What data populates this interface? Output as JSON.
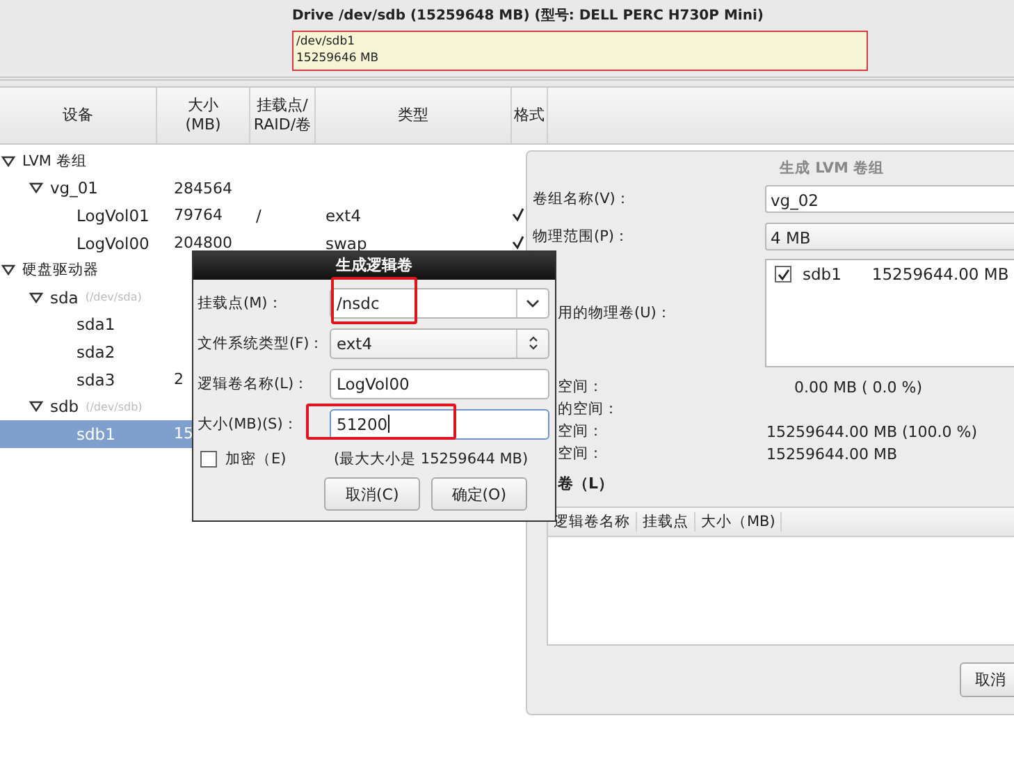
{
  "drive": {
    "title": "Drive /dev/sdb (15259648 MB) (型号: DELL PERC H730P Mini)",
    "partition": {
      "path": "/dev/sdb1",
      "size": "15259646 MB"
    }
  },
  "table": {
    "columns": [
      "设备",
      "大小\n(MB)",
      "挂载点/\nRAID/卷",
      "类型",
      "格式"
    ],
    "rows": [
      {
        "label": "LVM 卷组",
        "expanded": true,
        "selected": false,
        "children": [
          {
            "label": "vg_01",
            "size": "284564",
            "expanded": true,
            "selected": false,
            "children": [
              {
                "label": "LogVol01",
                "size": "79764",
                "mount": "/",
                "type": "ext4",
                "format": true,
                "selected": false
              },
              {
                "label": "LogVol00",
                "size": "204800",
                "type": "swap",
                "format": true,
                "selected": false
              }
            ]
          }
        ]
      },
      {
        "label": "硬盘驱动器",
        "expanded": true,
        "selected": false,
        "children": [
          {
            "label": "sda",
            "path": "(/dev/sda)",
            "expanded": true,
            "selected": false,
            "children": [
              {
                "label": "sda1",
                "selected": false
              },
              {
                "label": "sda2",
                "selected": false
              },
              {
                "label": "sda3",
                "size": "2",
                "selected": false
              }
            ]
          },
          {
            "label": "sdb",
            "path": "(/dev/sdb)",
            "expanded": true,
            "selected": false,
            "children": [
              {
                "label": "sdb1",
                "size": "15",
                "selected": true
              }
            ]
          }
        ]
      }
    ]
  },
  "vg_dialog": {
    "title": "生成 LVM 卷组",
    "name_label": "卷组名称(V)：",
    "name_value": "vg_02",
    "extent_label": "物理范围(P)：",
    "extent_value": "4 MB",
    "pv_label": "用的物理卷(U)：",
    "pvs": [
      {
        "name": "sdb1",
        "size": "15259644.00 MB",
        "checked": true
      }
    ],
    "stats": [
      {
        "label": "空间：",
        "value": "0.00 MB  ( 0.0 %)"
      },
      {
        "label": "的空间："
      },
      {
        "label": "空间：",
        "value": "15259644.00 MB  (100.0 %)"
      },
      {
        "label": "空间：",
        "value": "15259644.00 MB"
      }
    ],
    "lv_heading": "卷（L）",
    "lv_columns": [
      "逻辑卷名称",
      "挂载点",
      "大小（MB)"
    ],
    "cancel": "取消"
  },
  "lv_dialog": {
    "title": "生成逻辑卷",
    "fields": [
      {
        "kind": "combo",
        "label": "挂载点(M)：",
        "value": "/nsdc",
        "highlighted": true,
        "focused": false
      },
      {
        "kind": "select",
        "label": "文件系统类型(F)：",
        "value": "ext4",
        "highlighted": false,
        "focused": false
      },
      {
        "kind": "entry",
        "label": "逻辑卷名称(L)：",
        "value": "LogVol00",
        "highlighted": false,
        "focused": false
      },
      {
        "kind": "entry",
        "label": "大小(MB)(S)：",
        "value": "51200",
        "highlighted": true,
        "focused": true
      }
    ],
    "encrypt": {
      "label": "加密（E)",
      "checked": false
    },
    "max_note": "(最大大小是 15259644 MB)",
    "buttons": [
      "取消(C)",
      "确定(O)"
    ]
  }
}
